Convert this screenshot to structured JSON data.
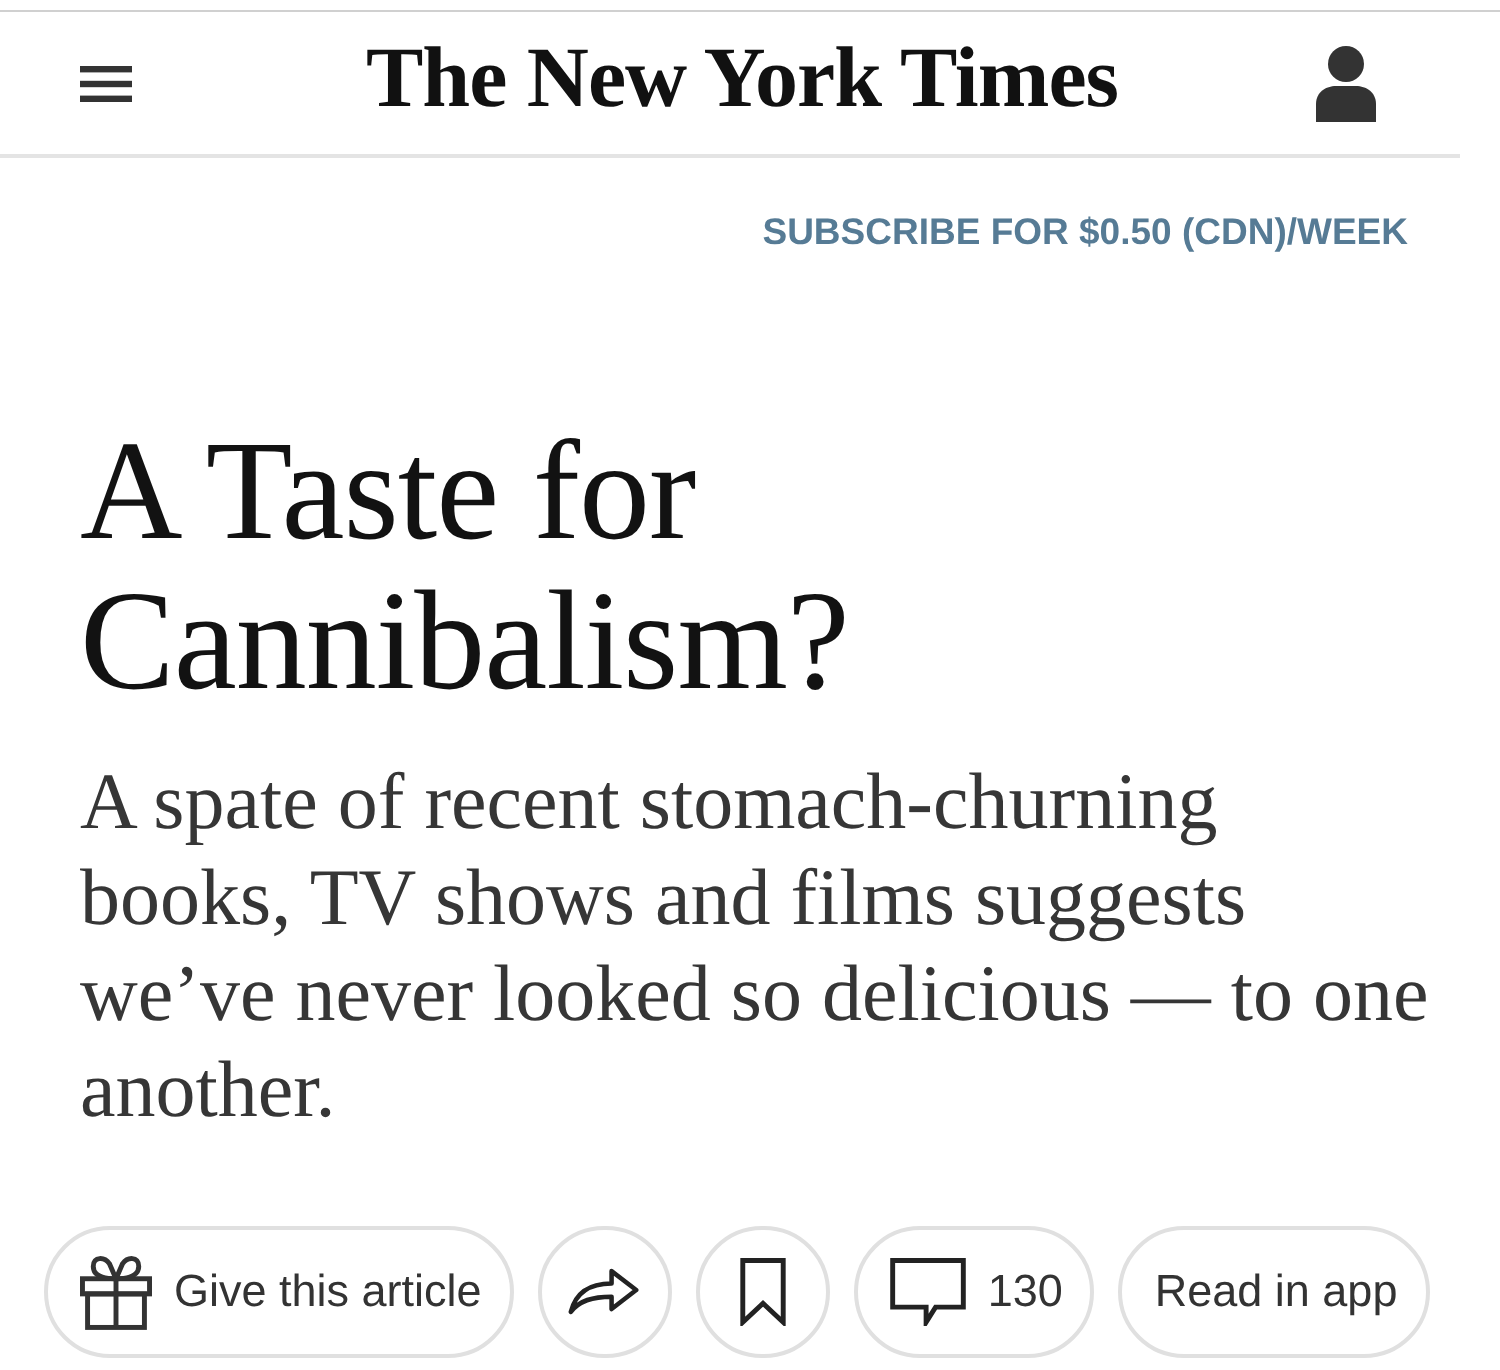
{
  "header": {
    "logo": "The New York Times"
  },
  "subscribe_link": "SUBSCRIBE FOR $0.50 (CDN)/WEEK",
  "headline": "A Taste for Cannibalism?",
  "summary": "A spate of recent stomach-churning books, TV shows and films suggests we’ve never looked so delicious — to one another.",
  "actions": [
    {
      "kind": "gift",
      "label": "Give this article"
    },
    {
      "kind": "share"
    },
    {
      "kind": "save"
    },
    {
      "kind": "comments",
      "label": "130"
    },
    {
      "kind": "app",
      "label": "Read in app"
    }
  ]
}
